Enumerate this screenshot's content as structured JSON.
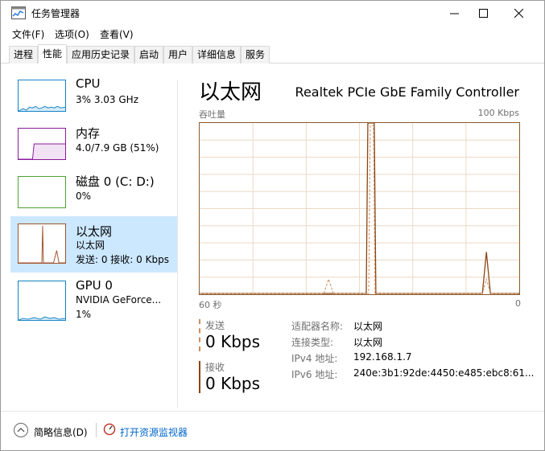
{
  "window": {
    "title": "任务管理器"
  },
  "menu": [
    "文件(F)",
    "选项(O)",
    "查看(V)"
  ],
  "tabs": [
    "进程",
    "性能",
    "应用历史记录",
    "启动",
    "用户",
    "详细信息",
    "服务"
  ],
  "sidebar": [
    {
      "title": "CPU",
      "sub1": "3% 3.03 GHz",
      "color": "#1583c6",
      "selected": false
    },
    {
      "title": "内存",
      "sub1": "4.0/7.9 GB (51%)",
      "color": "#8b1a9b",
      "selected": false
    },
    {
      "title": "磁盘 0 (C: D:)",
      "sub1": "0%",
      "color": "#4da033",
      "selected": false
    },
    {
      "title": "以太网",
      "sub1": "以太网",
      "sub2": "发送: 0 接收: 0 Kbps",
      "color": "#a0522d",
      "selected": true
    },
    {
      "title": "GPU 0",
      "sub1": "NVIDIA GeForce...",
      "sub2": "1%",
      "color": "#1583c6",
      "selected": false
    }
  ],
  "main": {
    "title": "以太网",
    "adapter": "Realtek PCIe GbE Family Controller",
    "graph_label": "吞吐量",
    "graph_max": "100 Kbps",
    "graph_left": "60 秒",
    "graph_right": "0",
    "send_label": "发送",
    "send_value": "0 Kbps",
    "recv_label": "接收",
    "recv_value": "0 Kbps",
    "details": [
      {
        "k": "适配器名称:",
        "v": "以太网"
      },
      {
        "k": "连接类型:",
        "v": "以太网"
      },
      {
        "k": "IPv4 地址:",
        "v": "192.168.1.7"
      },
      {
        "k": "IPv6 地址:",
        "v": "240e:3b1:92de:4450:e485:ebc8:61..."
      }
    ]
  },
  "footer": {
    "less": "简略信息(D)",
    "monitor": "打开资源监视器"
  }
}
